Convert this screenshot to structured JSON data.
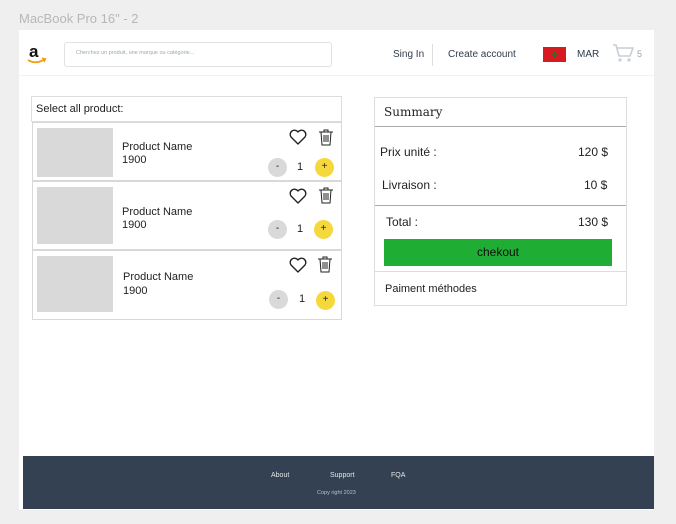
{
  "frame_title": "MacBook Pro 16\" - 2",
  "header": {
    "logo_icon": "amazon-logo-icon",
    "search_placeholder": "Cherchez un produit, une marque ou catégorie...",
    "signin_label": "Sing In",
    "create_account_label": "Create account",
    "country_flag_color": "#d71920",
    "language_label": "MAR",
    "cart_icon": "cart-icon",
    "cart_count": "5"
  },
  "cart": {
    "select_all_label": "Select all product:",
    "items": [
      {
        "name": "Product Name",
        "price": "1900",
        "quantity": "1",
        "minus_label": "-",
        "plus_label": "+"
      },
      {
        "name": "Product Name",
        "price": "1900",
        "quantity": "1",
        "minus_label": "-",
        "plus_label": "+"
      },
      {
        "name": "Product Name",
        "price": "1900",
        "quantity": "1",
        "minus_label": "-",
        "plus_label": "+"
      }
    ]
  },
  "summary": {
    "title": "Summary",
    "unit_price_label": "Prix unité :",
    "unit_price_value": "120 $",
    "shipping_label": "Livraison :",
    "shipping_value": "10 $",
    "total_label": "Total :",
    "total_value": "130 $",
    "checkout_label": "chekout",
    "checkout_color": "#1fae33",
    "payment_methods_label": "Paiment méthodes"
  },
  "footer": {
    "links": [
      "About",
      "Support",
      "FQA"
    ],
    "copyright": "Copy right 2023",
    "background_color": "#334152"
  }
}
